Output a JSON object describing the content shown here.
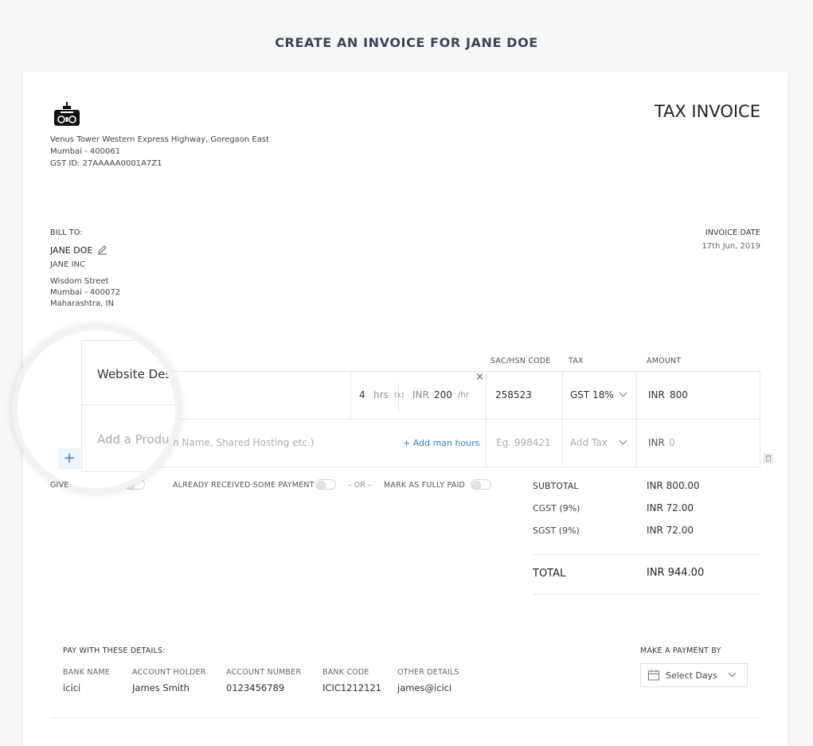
{
  "page": {
    "title": "CREATE AN INVOICE FOR JANE DOE"
  },
  "company": {
    "address_line1": "Venus Tower Western Express Highway, Goregaon East",
    "address_line2": "Mumbai - 400061",
    "gst": "GST ID: 27AAAAA0001A7Z1"
  },
  "invoice": {
    "heading": "TAX INVOICE",
    "date_label": "INVOICE DATE",
    "date_value": "17th Jun, 2019"
  },
  "bill_to": {
    "label": "BILL TO:",
    "name": "JANE DOE",
    "company": "JANE INC",
    "street": "Wisdom Street",
    "city": "Mumbai - 400072",
    "state": "Maharashtra, IN"
  },
  "table": {
    "headers": {
      "sac": "SAC/HSN CODE",
      "tax": "TAX",
      "amount": "AMOUNT"
    },
    "row1": {
      "description": "Website Des",
      "qty": "4",
      "qty_unit": "hrs",
      "times": "(x)",
      "rate_currency": "INR",
      "rate": "200",
      "rate_unit": "/hr",
      "sac": "258523",
      "tax": "GST 18%",
      "amount_currency": "INR",
      "amount": "800",
      "remove": "×"
    },
    "row2": {
      "description_placeholder": "Add a Produc",
      "description_placeholder_rest": "n Name, Shared Hosting etc.)",
      "add_hours": "+ Add man hours",
      "sac_placeholder": "Eg. 998421",
      "tax_placeholder": "Add Tax",
      "amount_currency": "INR",
      "amount": "0"
    },
    "add_row": "+"
  },
  "options": {
    "give_label": "GIVE",
    "received_payment": "ALREADY RECEIVED SOME PAYMENT",
    "or": "OR",
    "fully_paid": "MARK AS FULLY PAID"
  },
  "totals": {
    "subtotal_label": "SUBTOTAL",
    "subtotal": "INR 800.00",
    "cgst_label": "CGST (9%)",
    "cgst": "INR 72.00",
    "sgst_label": "SGST (9%)",
    "sgst": "INR 72.00",
    "total_label": "TOTAL",
    "total": "INR 944.00"
  },
  "payment": {
    "label": "PAY WITH THESE DETAILS:",
    "columns": [
      {
        "header": "BANK NAME",
        "value": "icici"
      },
      {
        "header": "ACCOUNT HOLDER",
        "value": "James Smith"
      },
      {
        "header": "ACCOUNT NUMBER",
        "value": "0123456789"
      },
      {
        "header": "BANK CODE",
        "value": "ICIC1212121"
      },
      {
        "header": "OTHER DETAILS",
        "value": "james@icici"
      }
    ],
    "make_payment_label": "MAKE A PAYMENT BY",
    "select_days": "Select Days"
  },
  "colors": {
    "accent": "#2f80d1",
    "text": "#2f3137",
    "border": "#e6e7ea"
  }
}
